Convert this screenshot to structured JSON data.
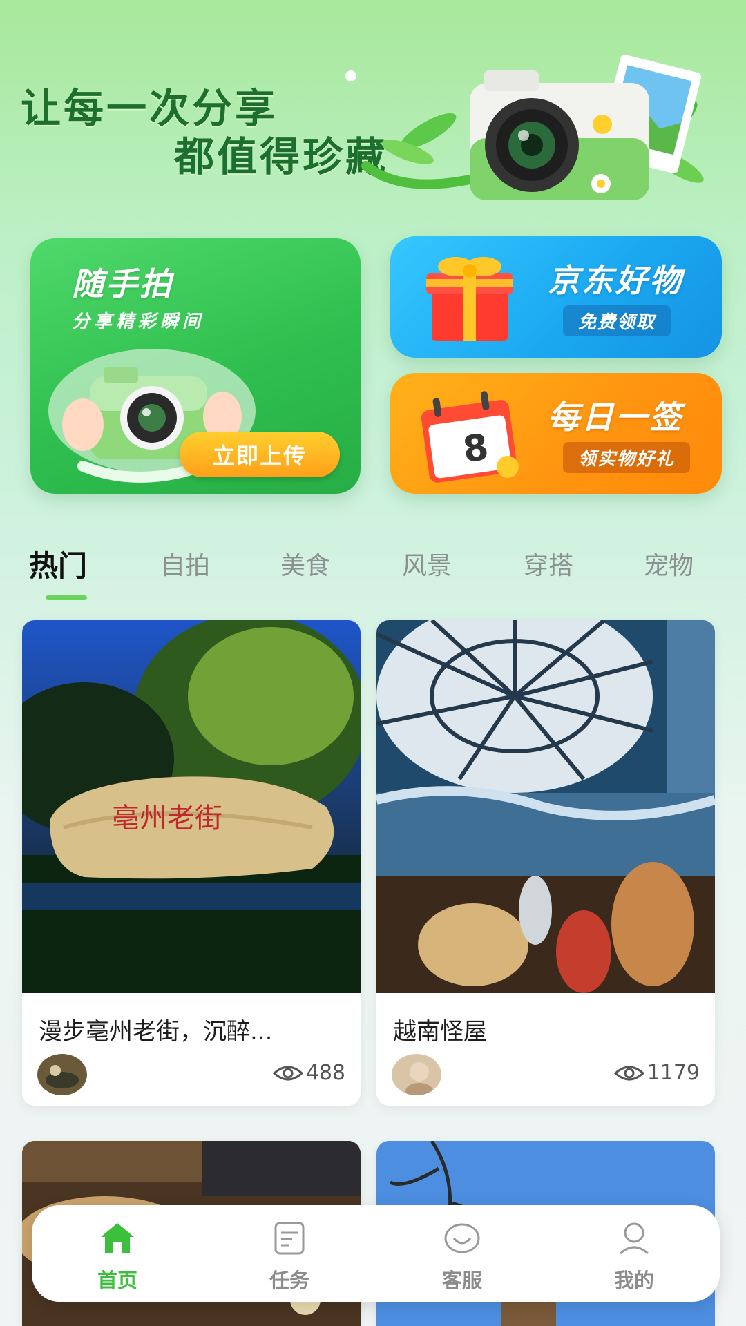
{
  "hero": {
    "slogan_line1": "让每一次分享",
    "slogan_line2": "都值得珍藏"
  },
  "cards": {
    "snap": {
      "title": "随手拍",
      "subtitle": "分享精彩瞬间",
      "button": "立即上传"
    },
    "jd": {
      "title": "京东好物",
      "badge": "免费领取"
    },
    "daily": {
      "title": "每日一签",
      "badge": "领实物好礼",
      "calendar_number": "8"
    }
  },
  "tabs": [
    "热门",
    "自拍",
    "美食",
    "风景",
    "穿搭",
    "宠物"
  ],
  "active_tab": "热门",
  "posts": [
    {
      "title": "漫步亳州老街，沉醉...",
      "views": "488",
      "image_text": "亳州老街"
    },
    {
      "title": "越南怪屋",
      "views": "1179"
    }
  ],
  "nav": [
    {
      "label": "首页",
      "icon": "home-icon",
      "active": true
    },
    {
      "label": "任务",
      "icon": "task-icon",
      "active": false
    },
    {
      "label": "客服",
      "icon": "customer-service-icon",
      "active": false
    },
    {
      "label": "我的",
      "icon": "profile-icon",
      "active": false
    }
  ],
  "colors": {
    "accent_green": "#3cbf3c",
    "card_green": "#2fbf4f",
    "card_blue": "#1aa7f0",
    "card_orange": "#ff9410"
  }
}
